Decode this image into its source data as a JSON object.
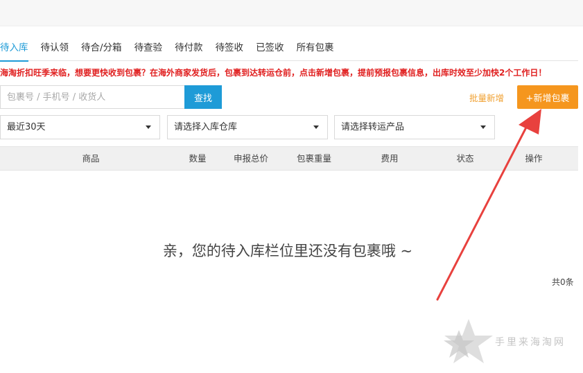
{
  "tabs": [
    {
      "label": "待入库",
      "active": true
    },
    {
      "label": "待认领",
      "active": false
    },
    {
      "label": "待合/分箱",
      "active": false
    },
    {
      "label": "待查验",
      "active": false
    },
    {
      "label": "待付款",
      "active": false
    },
    {
      "label": "待签收",
      "active": false
    },
    {
      "label": "已签收",
      "active": false
    },
    {
      "label": "所有包裹",
      "active": false
    }
  ],
  "notice": "海淘折扣旺季来临，想要更快收到包裹？在海外商家发货后，包裹到达转运仓前，点击新增包裹，提前预报包裹信息，出库时效至少加快2个工作日！",
  "search": {
    "placeholder": "包裹号 / 手机号 / 收货人",
    "value": "",
    "button_label": "查找"
  },
  "actions": {
    "batch_add": "批量新增",
    "add_package": "+新增包裹"
  },
  "filters": {
    "date_range": "最近30天",
    "warehouse": "请选择入库仓库",
    "product": "请选择转运产品"
  },
  "table": {
    "columns": [
      "商品",
      "数量",
      "申报总价",
      "包裹重量",
      "费用",
      "状态",
      "操作"
    ],
    "rows": []
  },
  "empty_message": "亲，您的待入库栏位里还没有包裹哦 ~",
  "total": "共0条",
  "watermark": "手里来海淘网",
  "colors": {
    "accent": "#1e9bd7",
    "warning": "#e02020",
    "orange": "#f5961e",
    "arrow": "#e8413e"
  }
}
